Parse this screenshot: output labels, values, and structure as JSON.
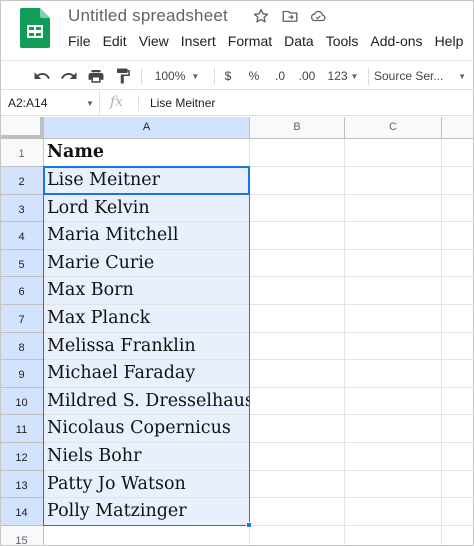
{
  "app": {
    "doc_title": "Untitled spreadsheet",
    "menus": [
      "File",
      "Edit",
      "View",
      "Insert",
      "Format",
      "Data",
      "Tools",
      "Add-ons",
      "Help"
    ]
  },
  "toolbar": {
    "zoom": "100%",
    "currency": "$",
    "percent": "%",
    "decrease_decimals": ".0",
    "increase_decimals": ".00",
    "more_formats": "123",
    "font": "Source Ser..."
  },
  "formula_bar": {
    "name_box": "A2:A14",
    "fx_label": "fx",
    "value": "Lise Meitner"
  },
  "grid": {
    "columns": [
      "A",
      "B",
      "C"
    ],
    "rows": [
      {
        "num": "1",
        "a": "Name"
      },
      {
        "num": "2",
        "a": "Lise Meitner"
      },
      {
        "num": "3",
        "a": "Lord Kelvin"
      },
      {
        "num": "4",
        "a": "Maria Mitchell"
      },
      {
        "num": "5",
        "a": "Marie Curie"
      },
      {
        "num": "6",
        "a": "Max Born"
      },
      {
        "num": "7",
        "a": "Max Planck"
      },
      {
        "num": "8",
        "a": "Melissa Franklin"
      },
      {
        "num": "9",
        "a": "Michael Faraday"
      },
      {
        "num": "10",
        "a": "Mildred S. Dresselhaus"
      },
      {
        "num": "11",
        "a": "Nicolaus Copernicus"
      },
      {
        "num": "12",
        "a": "Niels Bohr"
      },
      {
        "num": "13",
        "a": "Patty Jo Watson"
      },
      {
        "num": "14",
        "a": "Polly Matzinger"
      },
      {
        "num": "15",
        "a": ""
      }
    ]
  },
  "colors": {
    "accent": "#1a73e8",
    "selection_fill": "#e8f0fe",
    "sheets_green": "#0f9d58"
  },
  "icons": [
    "sheets-logo-icon",
    "star-icon",
    "move-to-folder-icon",
    "cloud-saved-icon",
    "undo-icon",
    "redo-icon",
    "print-icon",
    "paint-format-icon"
  ]
}
